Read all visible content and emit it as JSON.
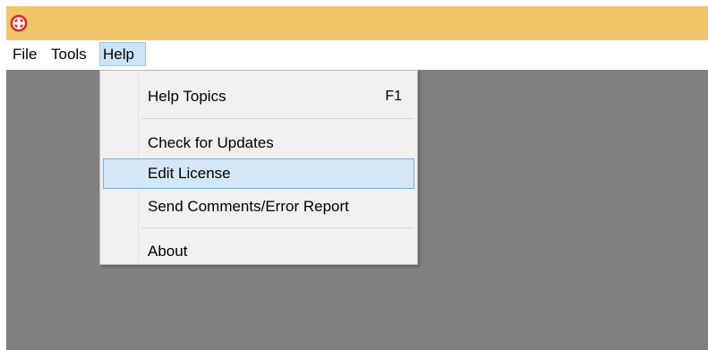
{
  "titlebar": {
    "color": "#f1c569",
    "icon": "app-logo-icon"
  },
  "menubar": {
    "items": [
      {
        "label": "File"
      },
      {
        "label": "Tools"
      },
      {
        "label": "Help"
      }
    ]
  },
  "help_menu": {
    "items": [
      {
        "label": "Help Topics",
        "shortcut": "F1"
      },
      {
        "label": "Check for Updates"
      },
      {
        "label": "Edit License"
      },
      {
        "label": "Send Comments/Error Report"
      },
      {
        "label": "About"
      }
    ],
    "highlighted": "Edit License"
  },
  "colors": {
    "workspace": "#808080",
    "menu_active": "#cce4f7",
    "item_hover": "#d5e6f6"
  }
}
